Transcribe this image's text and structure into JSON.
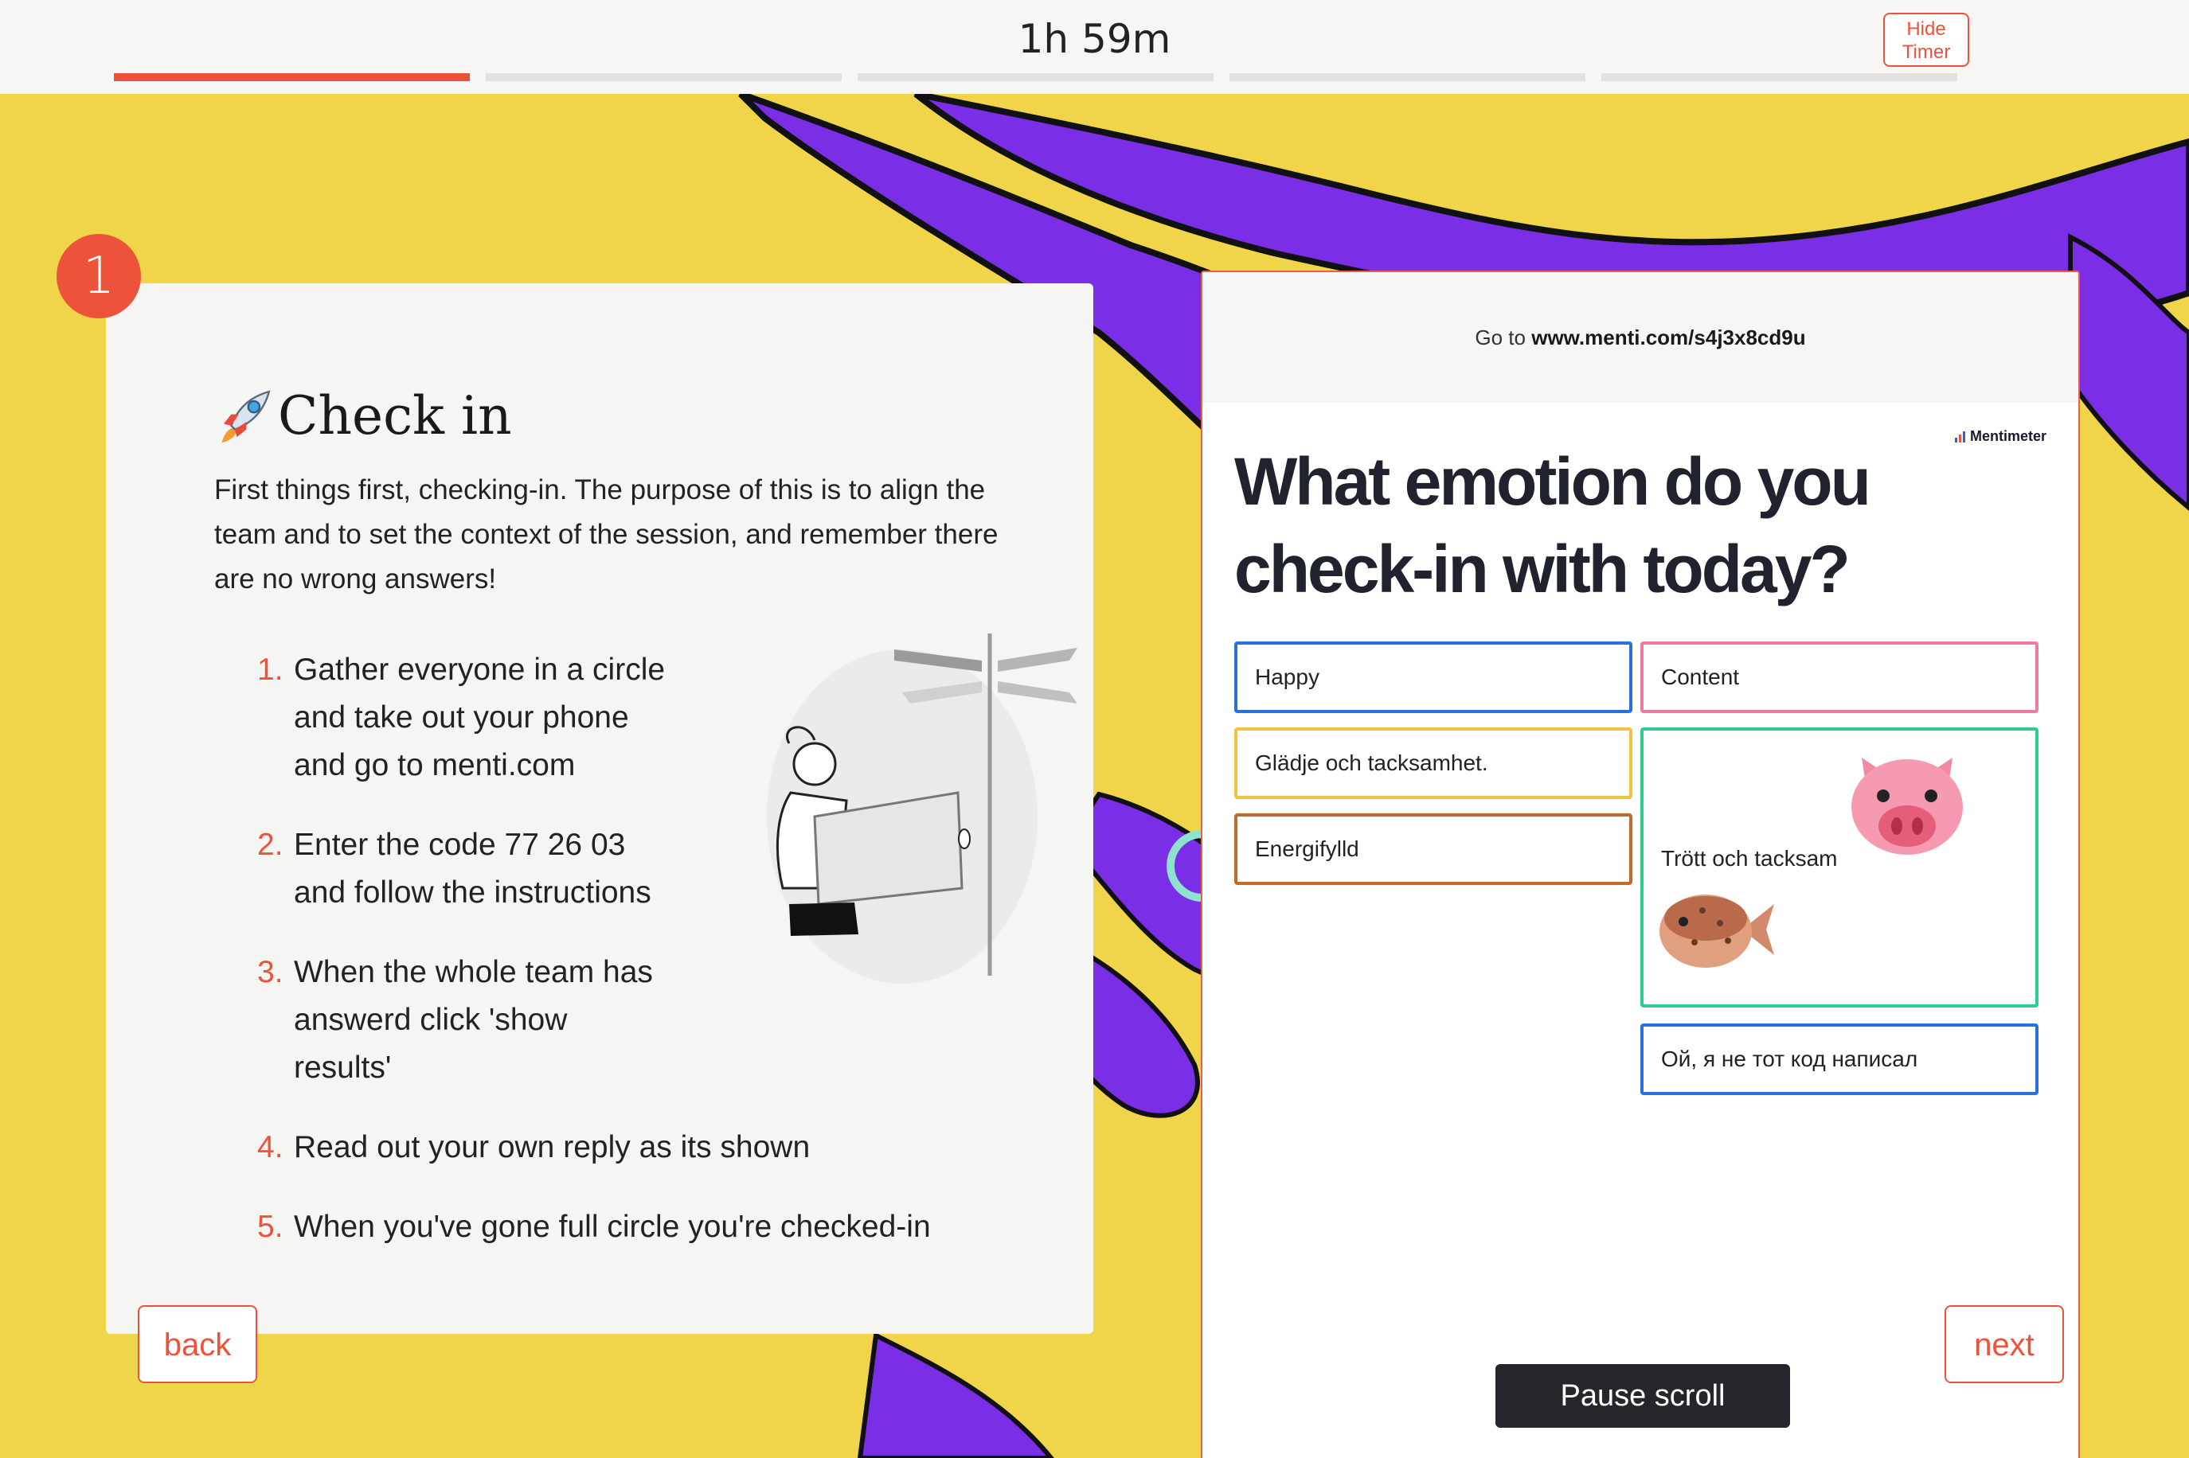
{
  "timer": {
    "value": "1h 59m",
    "hide_label_line1": "Hide",
    "hide_label_line2": "Timer",
    "progress_segments": 5,
    "progress_active_index": 0
  },
  "step": {
    "number": "1",
    "title": "Check in",
    "title_icon": "rocket-icon",
    "intro": "First things first, checking-in. The purpose of this is to align the team and to set the context of the session, and remember there are no wrong answers!",
    "items": [
      {
        "num": "1.",
        "text": "Gather everyone in a circle and take out your phone and go to menti.com"
      },
      {
        "num": "2.",
        "text": "Enter the code 77 26 03 and follow the instructions"
      },
      {
        "num": "3.",
        "text": "When the whole team has answerd click 'show results'"
      },
      {
        "num": "4.",
        "text": "Read out your own reply as its shown"
      },
      {
        "num": "5.",
        "text": "When you've gone full circle you're checked-in"
      }
    ]
  },
  "menti": {
    "goto_prefix": "Go to",
    "url": "www.menti.com/s4j3x8cd9u",
    "logo": "Mentimeter",
    "question": "What emotion do you check-in with today?",
    "answers": [
      {
        "text": "Happy",
        "color": "#2a6fe0"
      },
      {
        "text": "Content",
        "color": "#f07aa0"
      },
      {
        "text": "Glädje och tacksamhet.",
        "color": "#f2c43d"
      },
      {
        "text": "Trött och tacksam",
        "color": "#2ecc8f",
        "emojis": [
          "pig-face-icon",
          "blowfish-icon"
        ]
      },
      {
        "text": "Energifylld",
        "color": "#c46a2a"
      },
      {
        "text": "Ой, я не тот код написал",
        "color": "#2a6fe0"
      }
    ],
    "pause_label": "Pause scroll"
  },
  "nav": {
    "back_label": "back",
    "next_label": "next"
  },
  "colors": {
    "accent": "#ec533a",
    "background": "#f0d449",
    "art_purple": "#7a2ee6"
  }
}
